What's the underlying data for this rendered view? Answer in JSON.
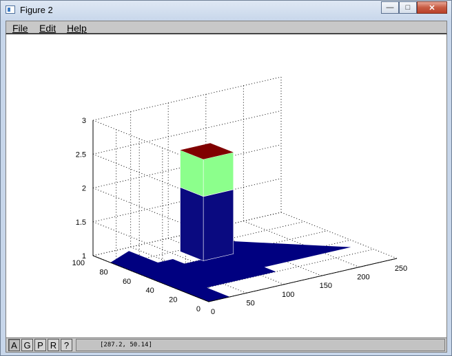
{
  "window": {
    "title": "Figure 2",
    "minimize_glyph": "—",
    "maximize_glyph": "□",
    "close_glyph": "✕"
  },
  "menu": {
    "items": [
      "File",
      "Edit",
      "Help"
    ]
  },
  "toolbar": {
    "buttons": [
      "A",
      "G",
      "P",
      "R",
      "?"
    ],
    "active_index": 0
  },
  "status": {
    "coordinates": "[287.2, 50.14]"
  },
  "chart_data": {
    "type": "surface3d",
    "title": "",
    "x_ticks": [
      "0",
      "50",
      "100",
      "150",
      "200",
      "250"
    ],
    "y_ticks": [
      "0",
      "20",
      "40",
      "60",
      "80",
      "100"
    ],
    "z_ticks": [
      "1",
      "1.5",
      "2",
      "2.5",
      "3"
    ],
    "xlim": [
      0,
      250
    ],
    "ylim": [
      0,
      100
    ],
    "zlim": [
      1,
      3
    ],
    "grid": true,
    "base_level": 1,
    "peak_level": 2.5,
    "colors": {
      "base": "#000080",
      "lower_wall": "#0a0a80",
      "upper_wall": "#8cff8c",
      "top": "#800000"
    }
  }
}
